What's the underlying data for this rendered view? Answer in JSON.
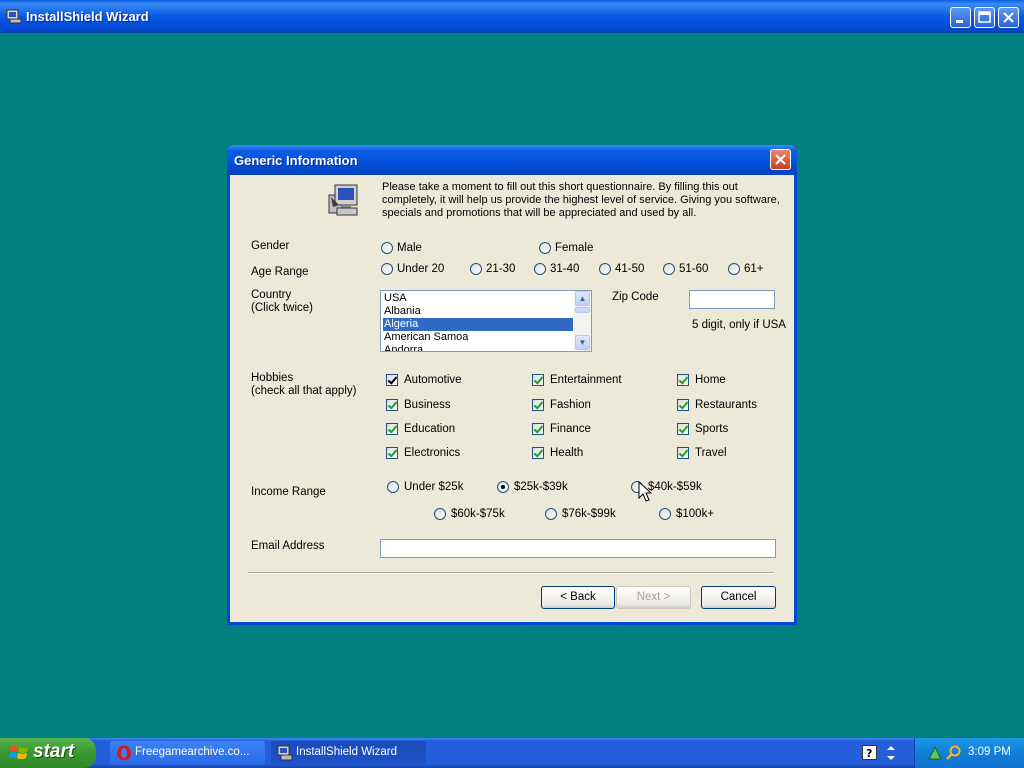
{
  "main_window": {
    "title": "InstallShield Wizard",
    "icons": [
      "installshield-icon",
      "minimize-icon",
      "maximize-icon",
      "close-icon"
    ]
  },
  "dialog": {
    "title": "Generic Information",
    "intro": "Please take a moment to fill out this short questionnaire. By filling this out completely, it will help us provide the highest level of service. Giving you software, specials and promotions that will be appreciated and used by all.",
    "gender": {
      "label": "Gender",
      "options": [
        "Male",
        "Female"
      ],
      "selected": ""
    },
    "age_range": {
      "label": "Age Range",
      "options": [
        "Under 20",
        "21-30",
        "31-40",
        "41-50",
        "51-60",
        "61+"
      ],
      "selected": ""
    },
    "country": {
      "label": "Country",
      "hint": "(Click twice)",
      "items": [
        "USA",
        "Albania",
        "Algeria",
        "American Samoa",
        "Andorra"
      ],
      "selected": "Algeria"
    },
    "zip": {
      "label": "Zip Code",
      "value": "",
      "hint": "5 digit, only if USA"
    },
    "hobbies": {
      "label": "Hobbies",
      "hint": "(check all that apply)",
      "items": [
        {
          "label": "Automotive",
          "checked": true
        },
        {
          "label": "Entertainment",
          "checked": true
        },
        {
          "label": "Home",
          "checked": true
        },
        {
          "label": "Business",
          "checked": true
        },
        {
          "label": "Fashion",
          "checked": true
        },
        {
          "label": "Restaurants",
          "checked": true
        },
        {
          "label": "Education",
          "checked": true
        },
        {
          "label": "Finance",
          "checked": true
        },
        {
          "label": "Sports",
          "checked": true
        },
        {
          "label": "Electronics",
          "checked": true
        },
        {
          "label": "Health",
          "checked": true
        },
        {
          "label": "Travel",
          "checked": true
        }
      ]
    },
    "income": {
      "label": "Income Range",
      "options": [
        "Under $25k",
        "$25k-$39k",
        "$40k-$59k",
        "$60k-$75k",
        "$76k-$99k",
        "$100k+"
      ],
      "selected": "$25k-$39k"
    },
    "email": {
      "label": "Email Address",
      "value": ""
    },
    "buttons": {
      "back": "< Back",
      "next": "Next >",
      "cancel": "Cancel"
    }
  },
  "taskbar": {
    "start_label": "start",
    "items": [
      {
        "label": "Freegamearchive.co...",
        "icon": "opera-icon",
        "active": false
      },
      {
        "label": "InstallShield Wizard",
        "icon": "installshield-icon",
        "active": true
      }
    ],
    "clock": "3:09 PM"
  },
  "colors": {
    "desktop": "#008080",
    "titlebar": "#0450db",
    "dialog_face": "#ece9d8",
    "selection": "#316ac5",
    "taskbar": "#245edb",
    "start_green": "#3c9a34"
  }
}
